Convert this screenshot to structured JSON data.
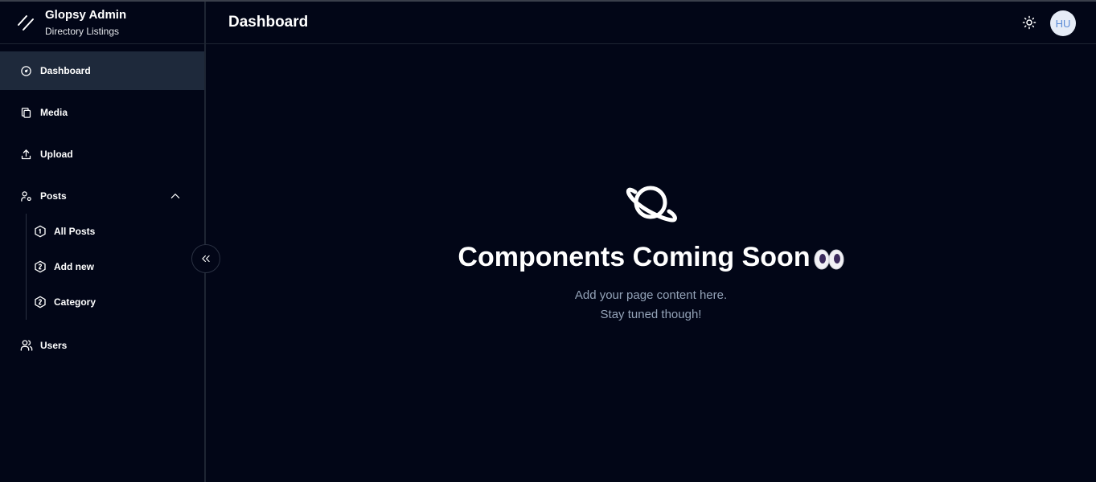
{
  "brand": {
    "title": "Glopsy Admin",
    "subtitle": "Directory Listings"
  },
  "sidebar": {
    "items": [
      {
        "label": "Dashboard",
        "icon": "gauge-icon"
      },
      {
        "label": "Media",
        "icon": "copy-icon"
      },
      {
        "label": "Upload",
        "icon": "upload-icon"
      },
      {
        "label": "Posts",
        "icon": "user-pin-icon"
      },
      {
        "label": "Users",
        "icon": "users-icon"
      }
    ],
    "posts_sub": [
      {
        "label": "All Posts",
        "icon": "hexagon-number-1-icon"
      },
      {
        "label": "Add new",
        "icon": "hexagon-number-2-icon"
      },
      {
        "label": "Category",
        "icon": "hexagon-number-2-icon"
      }
    ]
  },
  "header": {
    "title": "Dashboard",
    "avatar_initials": "HU"
  },
  "main": {
    "headline": "Components Coming Soon",
    "line1": "Add your page content here.",
    "line2": "Stay tuned though!"
  },
  "colors": {
    "background": "#020617",
    "active_item": "#1e293b",
    "muted_text": "#94a3b8",
    "avatar_bg": "#e6ecf7"
  }
}
